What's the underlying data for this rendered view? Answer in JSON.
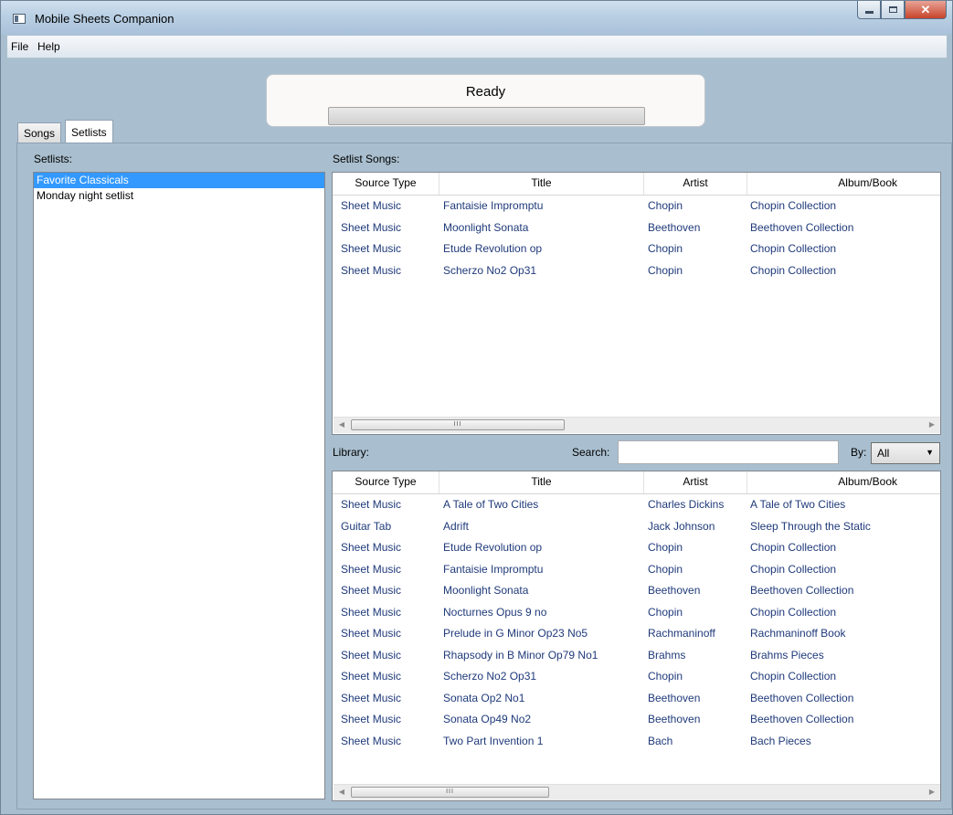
{
  "window": {
    "title": "Mobile Sheets Companion"
  },
  "menu": {
    "items": [
      "File",
      "Help"
    ]
  },
  "status": {
    "text": "Ready",
    "progress": 0
  },
  "tabs": [
    {
      "label": "Songs",
      "active": false
    },
    {
      "label": "Setlists",
      "active": true
    }
  ],
  "setlists": {
    "label": "Setlists:",
    "items": [
      "Favorite Classicals",
      "Monday night setlist"
    ],
    "selected_index": 0
  },
  "setlist_songs": {
    "label": "Setlist Songs:",
    "columns": [
      "Source Type",
      "Title",
      "Artist",
      "Album/Book"
    ],
    "rows": [
      [
        "Sheet Music",
        "Fantaisie Impromptu",
        "Chopin",
        "Chopin Collection"
      ],
      [
        "Sheet Music",
        "Moonlight Sonata",
        "Beethoven",
        "Beethoven Collection"
      ],
      [
        "Sheet Music",
        "Etude Revolution op",
        "Chopin",
        "Chopin Collection"
      ],
      [
        "Sheet Music",
        "Scherzo No2 Op31",
        "Chopin",
        "Chopin Collection"
      ]
    ]
  },
  "library": {
    "label": "Library:",
    "search_label": "Search:",
    "search_value": "",
    "by_label": "By:",
    "by_value": "All",
    "columns": [
      "Source Type",
      "Title",
      "Artist",
      "Album/Book"
    ],
    "rows": [
      [
        "Sheet Music",
        "A Tale of Two Cities",
        "Charles Dickins",
        "A Tale of Two Cities"
      ],
      [
        "Guitar Tab",
        "Adrift",
        "Jack Johnson",
        "Sleep Through the Static"
      ],
      [
        "Sheet Music",
        "Etude Revolution op",
        "Chopin",
        "Chopin Collection"
      ],
      [
        "Sheet Music",
        "Fantaisie Impromptu",
        "Chopin",
        "Chopin Collection"
      ],
      [
        "Sheet Music",
        "Moonlight Sonata",
        "Beethoven",
        "Beethoven Collection"
      ],
      [
        "Sheet Music",
        "Nocturnes Opus 9 no",
        "Chopin",
        "Chopin Collection"
      ],
      [
        "Sheet Music",
        "Prelude in G Minor Op23 No5",
        "Rachmaninoff",
        "Rachmaninoff Book"
      ],
      [
        "Sheet Music",
        "Rhapsody in B Minor Op79 No1",
        "Brahms",
        "Brahms Pieces"
      ],
      [
        "Sheet Music",
        "Scherzo No2 Op31",
        "Chopin",
        "Chopin Collection"
      ],
      [
        "Sheet Music",
        "Sonata Op2 No1",
        "Beethoven",
        "Beethoven Collection"
      ],
      [
        "Sheet Music",
        "Sonata Op49 No2",
        "Beethoven",
        "Beethoven Collection"
      ],
      [
        "Sheet Music",
        "Two Part Invention 1",
        "Bach",
        "Bach Pieces"
      ]
    ]
  },
  "scrollbar": {
    "thumb_glyph": "III"
  },
  "colors": {
    "selection": "#3399ff",
    "cell_text": "#1f3a7a",
    "background": "#a9bfcf"
  }
}
